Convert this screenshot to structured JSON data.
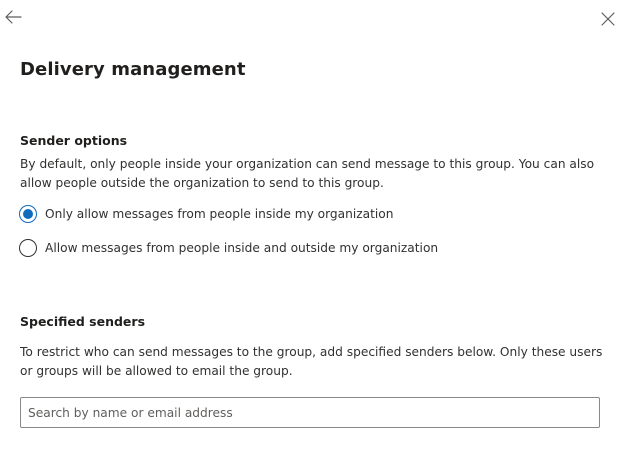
{
  "header": {
    "back_icon": "arrow-left-icon",
    "close_icon": "close-icon"
  },
  "title": "Delivery management",
  "sender_options": {
    "heading": "Sender options",
    "description": "By default, only people inside your organization can send message to this group. You can also allow people outside the organization to send to this group.",
    "options": [
      {
        "label": "Only allow messages from people inside my organization",
        "selected": true
      },
      {
        "label": "Allow messages from people inside and outside my organization",
        "selected": false
      }
    ]
  },
  "specified_senders": {
    "heading": "Specified senders",
    "description": "To restrict who can send messages to the group, add specified senders below. Only these users or groups will be allowed to email the group.",
    "search": {
      "placeholder": "Search by name or email address",
      "value": ""
    }
  },
  "colors": {
    "accent": "#0f6cbd",
    "text": "#323130",
    "border": "#8a8886"
  }
}
